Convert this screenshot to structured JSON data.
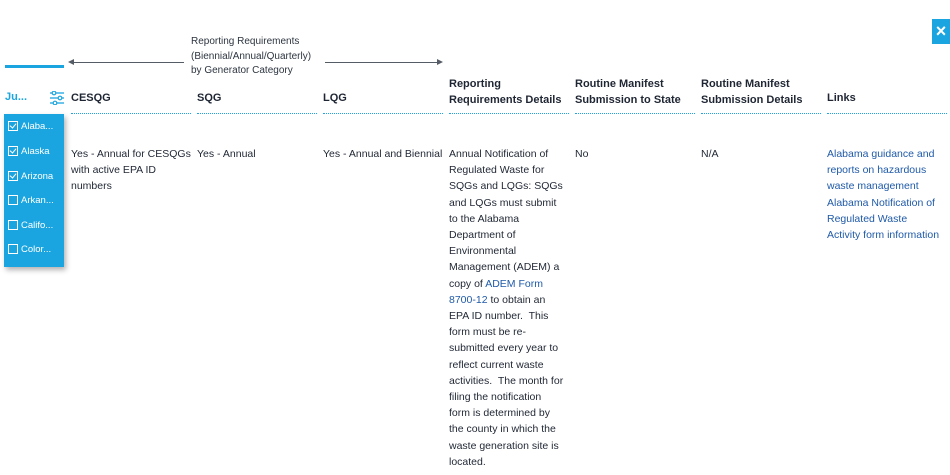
{
  "close_label": "×",
  "group_header": {
    "line1": "Reporting Requirements",
    "line2": "(Biennial/Annual/Quarterly)",
    "line3": "by Generator Category"
  },
  "columns": {
    "jurisdiction": "Ju...",
    "cesqg": "CESQG",
    "sqg": "SQG",
    "lqg": "LQG",
    "reporting_details": [
      "Reporting",
      "Requirements Details"
    ],
    "routine_state": [
      "Routine Manifest",
      "Submission to State"
    ],
    "routine_details": [
      "Routine Manifest",
      "Submission Details"
    ],
    "links": "Links"
  },
  "dropdown_options": [
    {
      "label": "Alaba...",
      "checked": true
    },
    {
      "label": "Alaska",
      "checked": true
    },
    {
      "label": "Arizona",
      "checked": true
    },
    {
      "label": "Arkan...",
      "checked": false
    },
    {
      "label": "Califo...",
      "checked": false
    },
    {
      "label": "Color...",
      "checked": false
    }
  ],
  "row": {
    "cesqg": [
      "Yes - Annual for CESQGs",
      "with active EPA ID",
      "numbers"
    ],
    "sqg": "Yes - Annual",
    "lqg": "Yes - Annual and Biennial",
    "details_before": [
      "Annual Notification of",
      "Regulated Waste for",
      "SQGs and LQGs: SQGs",
      "and LQGs must submit",
      "to the Alabama",
      "Department of",
      "Environmental",
      "Management (ADEM) a"
    ],
    "details_link_prefix": "copy of ",
    "details_link_1": "ADEM Form",
    "details_link_2": "8700-12",
    "details_link_suffix": " to obtain an",
    "details_after": [
      "EPA ID number.  This",
      "form must be re-",
      "submitted every year to",
      "reflect current waste",
      "activities.  The month for",
      "filing the notification",
      "form is determined by",
      "the county in which the",
      "waste generation site is",
      "located."
    ],
    "routine_state": "No",
    "routine_details": "N/A",
    "links": [
      "Alabama guidance and",
      "reports on hazardous",
      "waste management",
      "Alabama Notification of",
      "Regulated Waste",
      "Activity form information"
    ]
  },
  "colors": {
    "accent": "#1ba5e0",
    "link": "#1f5aa8",
    "text": "#1f2633"
  }
}
